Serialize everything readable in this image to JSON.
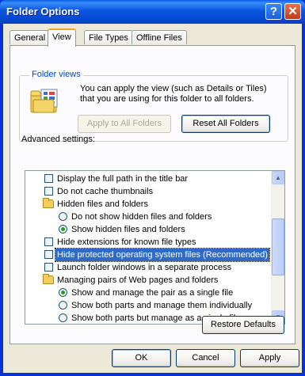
{
  "window": {
    "title": "Folder Options",
    "help_glyph": "?",
    "close_glyph": "✕"
  },
  "tabs": [
    {
      "label": "General"
    },
    {
      "label": "View",
      "active": true
    },
    {
      "label": "File Types"
    },
    {
      "label": "Offline Files"
    }
  ],
  "folder_views": {
    "legend": "Folder views",
    "description": "You can apply the view (such as Details or Tiles) that you are using for this folder to all folders.",
    "apply_label": "Apply to All Folders",
    "reset_label": "Reset All Folders"
  },
  "advanced": {
    "label": "Advanced settings:",
    "items": [
      {
        "type": "checkbox",
        "checked": false,
        "label": "Display the full path in the title bar"
      },
      {
        "type": "checkbox",
        "checked": false,
        "label": "Do not cache thumbnails"
      },
      {
        "type": "folder",
        "label": "Hidden files and folders"
      },
      {
        "type": "radio",
        "checked": false,
        "label": "Do not show hidden files and folders"
      },
      {
        "type": "radio",
        "checked": true,
        "label": "Show hidden files and folders"
      },
      {
        "type": "checkbox",
        "checked": false,
        "label": "Hide extensions for known file types"
      },
      {
        "type": "checkbox",
        "checked": false,
        "selected": true,
        "label": "Hide protected operating system files (Recommended)"
      },
      {
        "type": "checkbox",
        "checked": false,
        "label": "Launch folder windows in a separate process"
      },
      {
        "type": "folder",
        "label": "Managing pairs of Web pages and folders"
      },
      {
        "type": "radio",
        "checked": true,
        "label": "Show and manage the pair as a single file"
      },
      {
        "type": "radio",
        "checked": false,
        "label": "Show both parts and manage them individually"
      },
      {
        "type": "radio",
        "checked": false,
        "label": "Show both parts but manage as a single file"
      }
    ],
    "restore_label": "Restore Defaults"
  },
  "footer": {
    "ok_label": "OK",
    "cancel_label": "Cancel",
    "apply_label": "Apply"
  }
}
